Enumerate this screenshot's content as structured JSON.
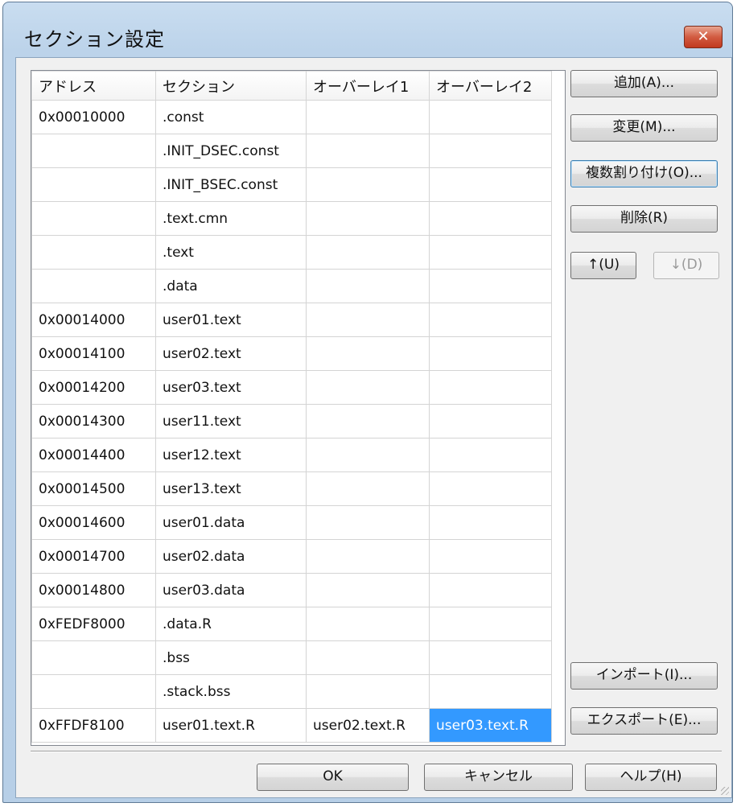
{
  "window": {
    "title": "セクション設定",
    "close_glyph": "✕"
  },
  "table": {
    "headers": [
      "アドレス",
      "セクション",
      "オーバーレイ1",
      "オーバーレイ2"
    ],
    "rows": [
      [
        "0x00010000",
        ".const",
        "",
        ""
      ],
      [
        "",
        ".INIT_DSEC.const",
        "",
        ""
      ],
      [
        "",
        ".INIT_BSEC.const",
        "",
        ""
      ],
      [
        "",
        ".text.cmn",
        "",
        ""
      ],
      [
        "",
        ".text",
        "",
        ""
      ],
      [
        "",
        ".data",
        "",
        ""
      ],
      [
        "0x00014000",
        "user01.text",
        "",
        ""
      ],
      [
        "0x00014100",
        "user02.text",
        "",
        ""
      ],
      [
        "0x00014200",
        "user03.text",
        "",
        ""
      ],
      [
        "0x00014300",
        "user11.text",
        "",
        ""
      ],
      [
        "0x00014400",
        "user12.text",
        "",
        ""
      ],
      [
        "0x00014500",
        "user13.text",
        "",
        ""
      ],
      [
        "0x00014600",
        "user01.data",
        "",
        ""
      ],
      [
        "0x00014700",
        "user02.data",
        "",
        ""
      ],
      [
        "0x00014800",
        "user03.data",
        "",
        ""
      ],
      [
        "0xFEDF8000",
        ".data.R",
        "",
        ""
      ],
      [
        "",
        ".bss",
        "",
        ""
      ],
      [
        "",
        ".stack.bss",
        "",
        ""
      ],
      [
        "0xFFDF8100",
        "user01.text.R",
        "user02.text.R",
        "user03.text.R"
      ]
    ],
    "selected_cell": {
      "row": 18,
      "col": 3
    }
  },
  "buttons": {
    "add": "追加(A)...",
    "change": "変更(M)...",
    "multi_assign": "複数割り付け(O)...",
    "delete": "削除(R)",
    "up": "↑(U)",
    "down": "↓(D)",
    "import": "インポート(I)...",
    "export": "エクスポート(E)...",
    "ok": "OK",
    "cancel": "キャンセル",
    "help": "ヘルプ(H)"
  },
  "colors": {
    "selection": "#3399ff",
    "title_close": "#d25b41"
  }
}
